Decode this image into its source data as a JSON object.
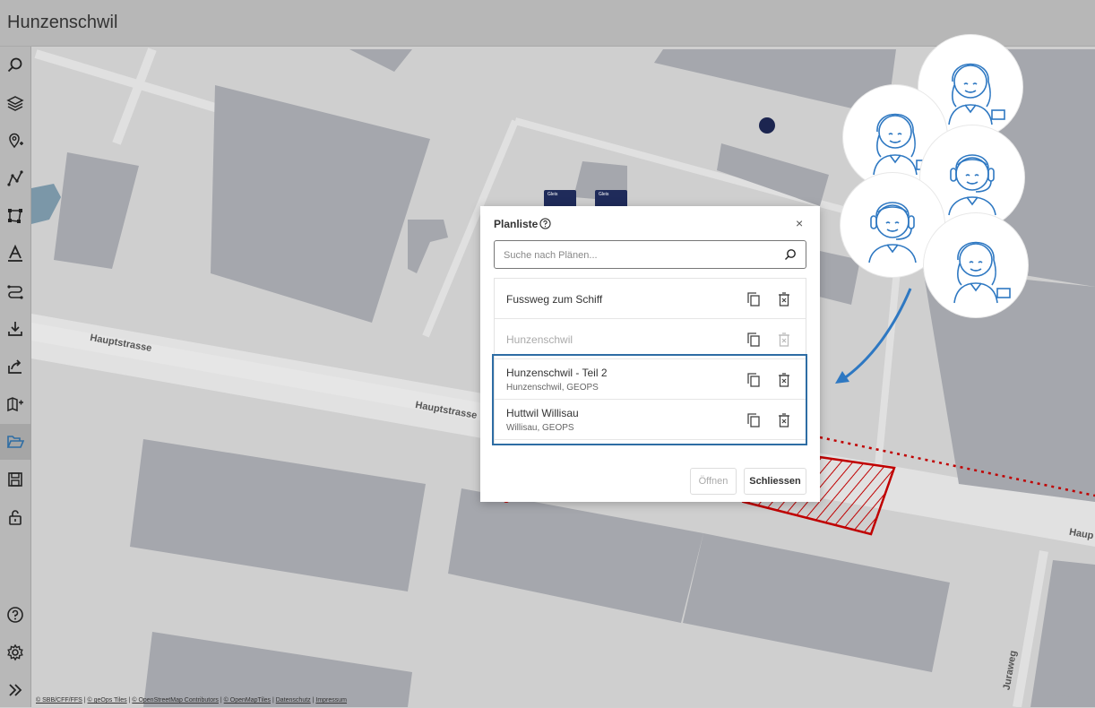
{
  "header": {
    "title": "Hunzenschwil"
  },
  "sidebar": {
    "top_items": [
      {
        "name": "search",
        "icon": "search-icon"
      },
      {
        "name": "layers",
        "icon": "layers-icon"
      },
      {
        "name": "add-point",
        "icon": "map-pin-plus-icon"
      },
      {
        "name": "draw-line",
        "icon": "polyline-icon"
      },
      {
        "name": "draw-polygon",
        "icon": "polygon-icon"
      },
      {
        "name": "text",
        "icon": "text-icon"
      },
      {
        "name": "route",
        "icon": "route-icon"
      },
      {
        "name": "download",
        "icon": "download-icon"
      },
      {
        "name": "share",
        "icon": "share-icon"
      },
      {
        "name": "add-map",
        "icon": "map-plus-icon"
      },
      {
        "name": "open",
        "icon": "folder-open-icon",
        "active": true
      },
      {
        "name": "save",
        "icon": "save-icon"
      },
      {
        "name": "lock",
        "icon": "unlock-icon"
      }
    ],
    "bottom_items": [
      {
        "name": "help",
        "icon": "help-icon"
      },
      {
        "name": "settings",
        "icon": "gear-icon"
      },
      {
        "name": "expand",
        "icon": "double-chevron-right-icon"
      }
    ]
  },
  "map": {
    "streets": [
      "Hauptstrasse",
      "Hauptstrasse",
      "Haup",
      "Juraweg"
    ],
    "stop_label": "Gleis",
    "attribution": [
      "© SBB/CFF/FFS",
      "© geOps Tiles",
      "© OpenStreetMap Contributors",
      "© OpenMapTiles",
      "Datenschutz",
      "Impressum"
    ]
  },
  "dialog": {
    "title": "Planliste",
    "search_placeholder": "Suche nach Plänen...",
    "items": [
      {
        "name": "Fussweg zum Schiff",
        "sub": "",
        "disabled": false
      },
      {
        "name": "Hunzenschwil",
        "sub": "",
        "disabled": true
      },
      {
        "name": "Hunzenschwil - Teil 2",
        "sub": "Hunzenschwil, GEOPS",
        "disabled": false
      },
      {
        "name": "Huttwil Willisau",
        "sub": "Willisau, GEOPS",
        "disabled": false
      }
    ],
    "open_label": "Öffnen",
    "close_label": "Schliessen"
  },
  "colors": {
    "accent": "#2e6da4",
    "highlight_line": "#c00000",
    "stop": "#1f2b5a"
  }
}
